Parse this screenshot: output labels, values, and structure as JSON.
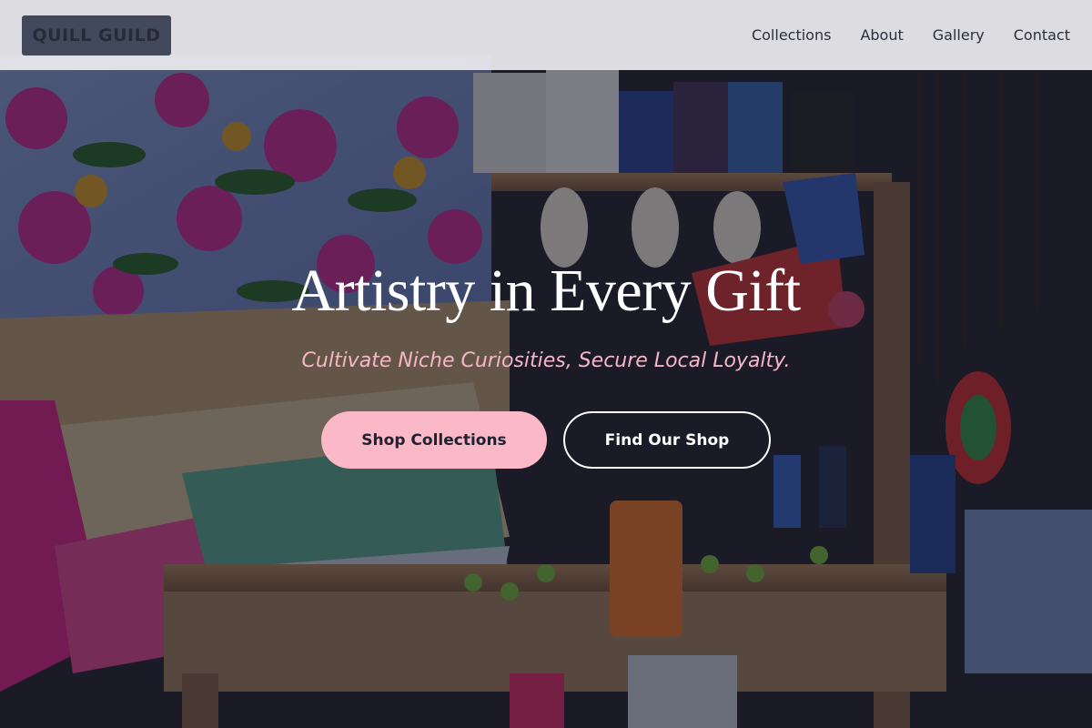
{
  "brand": {
    "logo_text": "QUILL GUILD"
  },
  "nav": {
    "items": [
      "Collections",
      "About",
      "Gallery",
      "Contact"
    ]
  },
  "hero": {
    "title": "Artistry in Every Gift",
    "subtitle": "Cultivate Niche Curiosities, Secure Local Loyalty.",
    "primary_cta": "Shop Collections",
    "secondary_cta": "Find Our Shop"
  },
  "colors": {
    "accent_pink": "#fbb8c7",
    "subtitle_pink": "#f7b6c6",
    "header_bg": "#ececf0",
    "logo_bg": "#3a4255",
    "text_dark": "#1e2230"
  }
}
